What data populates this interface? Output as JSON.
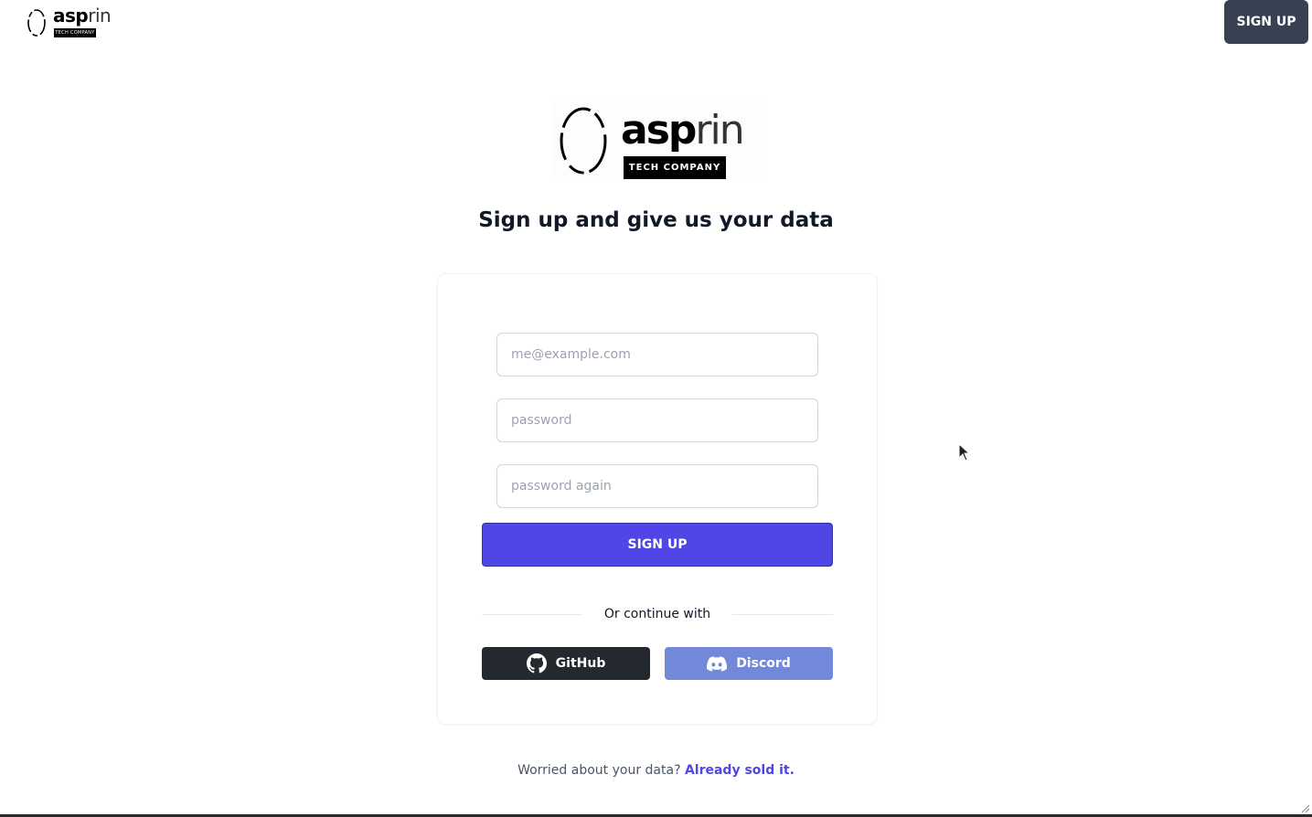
{
  "nav": {
    "logo_word_a": "asp",
    "logo_word_b": "rin",
    "logo_sub": "TECH COMPANY",
    "signup_label": "SIGN UP"
  },
  "hero": {
    "logo_word_a": "asp",
    "logo_word_b": "rin",
    "logo_tag": "TECH COMPANY",
    "headline": "Sign up and give us your data"
  },
  "form": {
    "email_placeholder": "me@example.com",
    "password_placeholder": "password",
    "password_again_placeholder": "password again",
    "submit_label": "SIGN UP",
    "divider_text": "Or continue with",
    "github_label": "GitHub",
    "discord_label": "Discord"
  },
  "footer": {
    "question": "Worried about your data?",
    "link_text": "Already sold it."
  },
  "colors": {
    "primary": "#4f46e5",
    "github": "#24292f",
    "discord": "#7289da",
    "nav_button": "#374151"
  },
  "icons": [
    "logo-ring-icon",
    "github-icon",
    "discord-icon",
    "mouse-cursor-icon"
  ]
}
